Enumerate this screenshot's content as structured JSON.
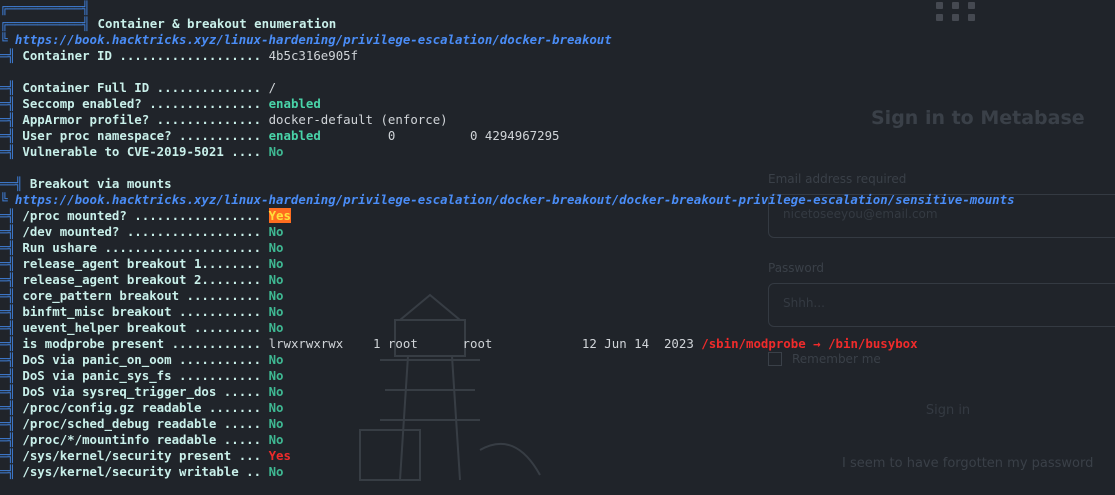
{
  "background_app": {
    "title": "Sign in to Metabase",
    "email_label": "Email address required",
    "email_placeholder": "nicetoseeyou@email.com",
    "password_label": "Password",
    "password_placeholder": "Shhh...",
    "remember_label": "Remember me",
    "signin_button": "Sign in",
    "forgot_link": "I seem to have forgotten my password"
  },
  "section1": {
    "title": "Container & breakout enumeration",
    "url": "https://book.hacktricks.xyz/linux-hardening/privilege-escalation/docker-breakout",
    "rows": [
      {
        "key": "Container ID ...................",
        "value": "4b5c316e905f"
      },
      {
        "key": "Container Full ID ..............",
        "value": "/"
      },
      {
        "key": "Seccomp enabled? ...............",
        "value": "enabled"
      },
      {
        "key": "AppArmor profile? ..............",
        "value": "docker-default (enforce)"
      },
      {
        "key": "User proc namespace? ...........",
        "value": "enabled",
        "extra": "         0          0 4294967295"
      },
      {
        "key": "Vulnerable to CVE-2019-5021 ....",
        "value": "No"
      }
    ]
  },
  "section2": {
    "title": "Breakout via mounts",
    "url": "https://book.hacktricks.xyz/linux-hardening/privilege-escalation/docker-breakout/docker-breakout-privilege-escalation/sensitive-mounts",
    "rows": [
      {
        "key": "/proc mounted? .................",
        "value": "Yes"
      },
      {
        "key": "/dev mounted? ..................",
        "value": "No"
      },
      {
        "key": "Run ushare .....................",
        "value": "No"
      },
      {
        "key": "release_agent breakout 1........",
        "value": "No"
      },
      {
        "key": "release_agent breakout 2........",
        "value": "No"
      },
      {
        "key": "core_pattern breakout ..........",
        "value": "No"
      },
      {
        "key": "binfmt_misc breakout ...........",
        "value": "No"
      },
      {
        "key": "uevent_helper breakout .........",
        "value": "No"
      },
      {
        "key": "is modprobe present ............",
        "value": "lrwxrwxrwx    1 root      root            12 Jun 14  2023 ",
        "link": "/sbin/modprobe → /bin/busybox"
      },
      {
        "key": "DoS via panic_on_oom ...........",
        "value": "No"
      },
      {
        "key": "DoS via panic_sys_fs ...........",
        "value": "No"
      },
      {
        "key": "DoS via sysreq_trigger_dos .....",
        "value": "No"
      },
      {
        "key": "/proc/config.gz readable .......",
        "value": "No"
      },
      {
        "key": "/proc/sched_debug readable .....",
        "value": "No"
      },
      {
        "key": "/proc/*/mountinfo readable .....",
        "value": "No"
      },
      {
        "key": "/sys/kernel/security present ...",
        "value": "Yes"
      },
      {
        "key": "/sys/kernel/security writable ..",
        "value": "No"
      }
    ]
  },
  "colors": {
    "background": "#20242a",
    "box": "#3f7fd8",
    "url": "#4a8df7",
    "key": "#c9f0ea",
    "ok": "#49d3a8",
    "danger": "#ef2b2b",
    "highlight_bg": "#ff6d1f",
    "highlight_fg": "#ffe13a"
  }
}
